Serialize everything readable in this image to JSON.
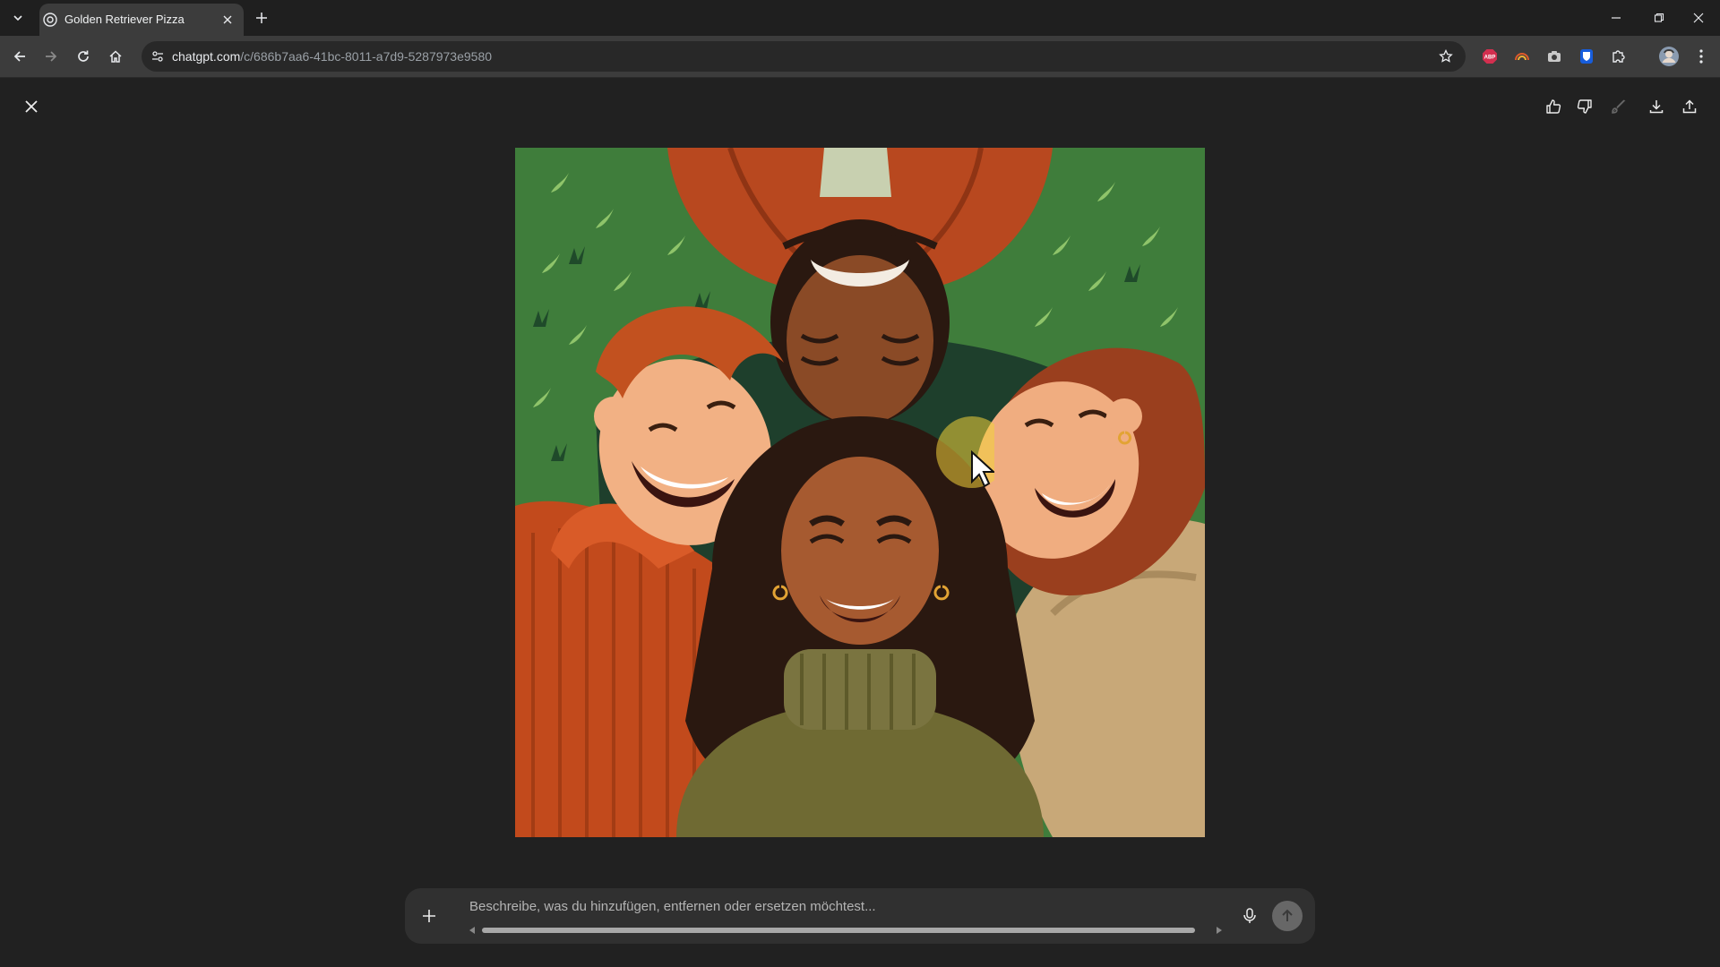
{
  "browser": {
    "tab": {
      "title": "Golden Retriever Pizza"
    },
    "address": {
      "domain": "chatgpt.com",
      "path": "/c/686b7aa6-41bc-8011-a7d9-5287973e9580"
    },
    "extensions": [
      "adblock-icon",
      "rainbow-icon",
      "camera-icon",
      "bitwarden-icon",
      "puzzle-icon",
      "profile-avatar"
    ]
  },
  "viewer": {
    "actions": [
      "thumbs-up-icon",
      "thumbs-down-icon",
      "edit-brush-icon",
      "download-icon",
      "share-icon"
    ],
    "image": {
      "subject": "four-smiling-friends-lying-on-grass-illustration",
      "palette": {
        "grass": "#3f7d3b",
        "leaves": "#8fc46a",
        "orange-sweater": "#c24a1c",
        "olive-sweater": "#6f6a33",
        "beige-sweater": "#c8a878"
      }
    }
  },
  "composer": {
    "placeholder": "Beschreibe, was du hinzufügen, entfernen oder ersetzen möchtest..."
  },
  "colors": {
    "page_bg": "#212121",
    "chrome_bg": "#1f1f1f",
    "toolbar_bg": "#3c3c3c",
    "composer_bg": "#303030"
  }
}
